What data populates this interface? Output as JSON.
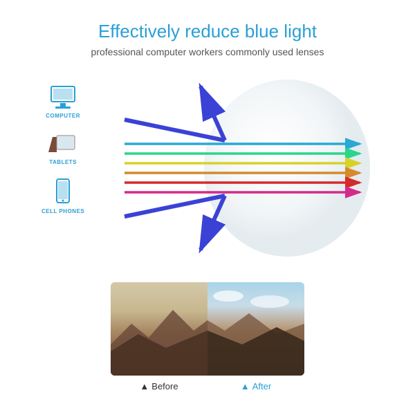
{
  "title": "Effectively reduce blue light",
  "subtitle": "professional computer workers commonly used lenses",
  "devices": [
    {
      "label": "COMPUTER"
    },
    {
      "label": "TABLETS"
    },
    {
      "label": "CELL PHONES"
    }
  ],
  "comparison": {
    "before": "Before",
    "after": "After"
  },
  "colors": {
    "accent": "#2a9fd6",
    "blue_arrow": "#3a42d6",
    "spectrum": [
      "#2aa8d6",
      "#2ad68a",
      "#d6d22a",
      "#d68a2a",
      "#d62a2a",
      "#d62a8a"
    ]
  }
}
